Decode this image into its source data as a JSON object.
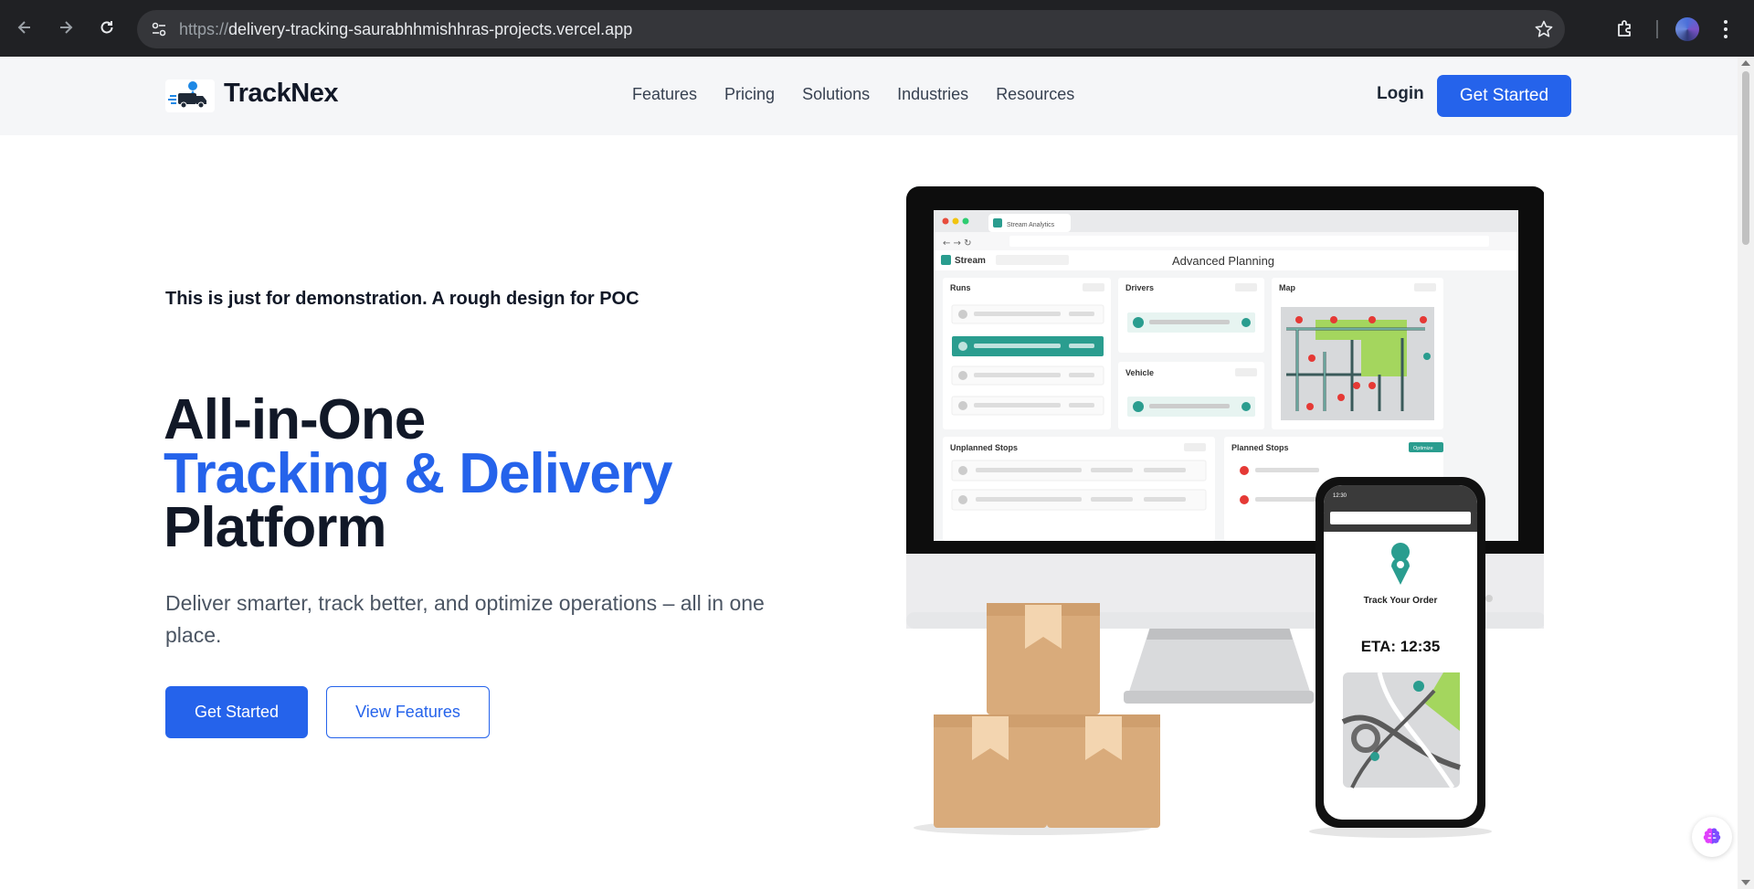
{
  "browser": {
    "url_scheme": "https://",
    "url_host": "delivery-tracking-saurabhhmishhras-projects.vercel.app",
    "icons": [
      "back-icon",
      "forward-icon",
      "reload-icon",
      "site-settings-icon",
      "bookmark-star-icon",
      "extensions-icon",
      "profile-avatar",
      "more-menu-icon"
    ]
  },
  "header": {
    "brand": "TrackNex",
    "nav": [
      "Features",
      "Pricing",
      "Solutions",
      "Industries",
      "Resources"
    ],
    "login": "Login",
    "cta": "Get Started"
  },
  "hero": {
    "note": "This is just for demonstration. A rough design for POC",
    "title_line1": "All-in-One",
    "title_line2": "Tracking & Delivery",
    "title_line3": "Platform",
    "subtitle": "Deliver smarter, track better, and optimize operations – all in one place.",
    "primary_button": "Get Started",
    "secondary_button": "View Features"
  },
  "illustration": {
    "tab_title": "Stream Analytics",
    "app_name": "Stream",
    "page_title": "Advanced Planning",
    "panels": [
      "Runs",
      "Drivers",
      "Map",
      "Vehicle",
      "Unplanned Stops",
      "Planned Stops"
    ],
    "optimize_badge": "Optimize",
    "phone_heading": "Track Your Order",
    "phone_eta": "ETA: 12:35",
    "phone_time": "12:30"
  },
  "colors": {
    "accent": "#2563eb",
    "heading": "#111827",
    "teal": "#2a9d8f"
  }
}
